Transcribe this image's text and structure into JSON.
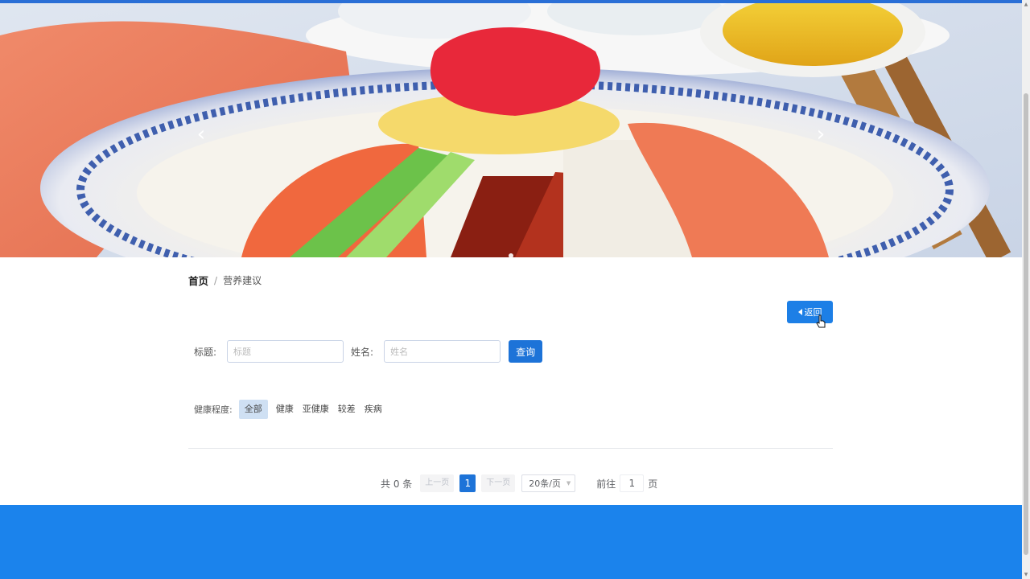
{
  "banner": {
    "image": "chilled-noodle-platter-photo",
    "prev_icon": "chevron-left-icon",
    "next_icon": "chevron-right-icon",
    "slides": 1,
    "active_slide": 1
  },
  "breadcrumb": {
    "home": "首页",
    "separator": "/",
    "current": "营养建议"
  },
  "back_button": {
    "label": "返回",
    "icon": "caret-left-icon"
  },
  "search": {
    "title_label": "标题:",
    "title_placeholder": "标题",
    "name_label": "姓名:",
    "name_placeholder": "姓名",
    "query_label": "查询"
  },
  "filters": {
    "label": "健康程度:",
    "options": [
      "全部",
      "健康",
      "亚健康",
      "较差",
      "疾病"
    ],
    "active": "全部"
  },
  "pagination": {
    "total": "共 0 条",
    "prev": "上一页",
    "current_page": "1",
    "next": "下一页",
    "page_size": "20条/页",
    "goto_prefix": "前往",
    "goto_value": "1",
    "goto_suffix": "页"
  },
  "colors": {
    "primary": "#1d73d8",
    "footer": "#1b83ec",
    "topline": "#2a6fd6"
  }
}
